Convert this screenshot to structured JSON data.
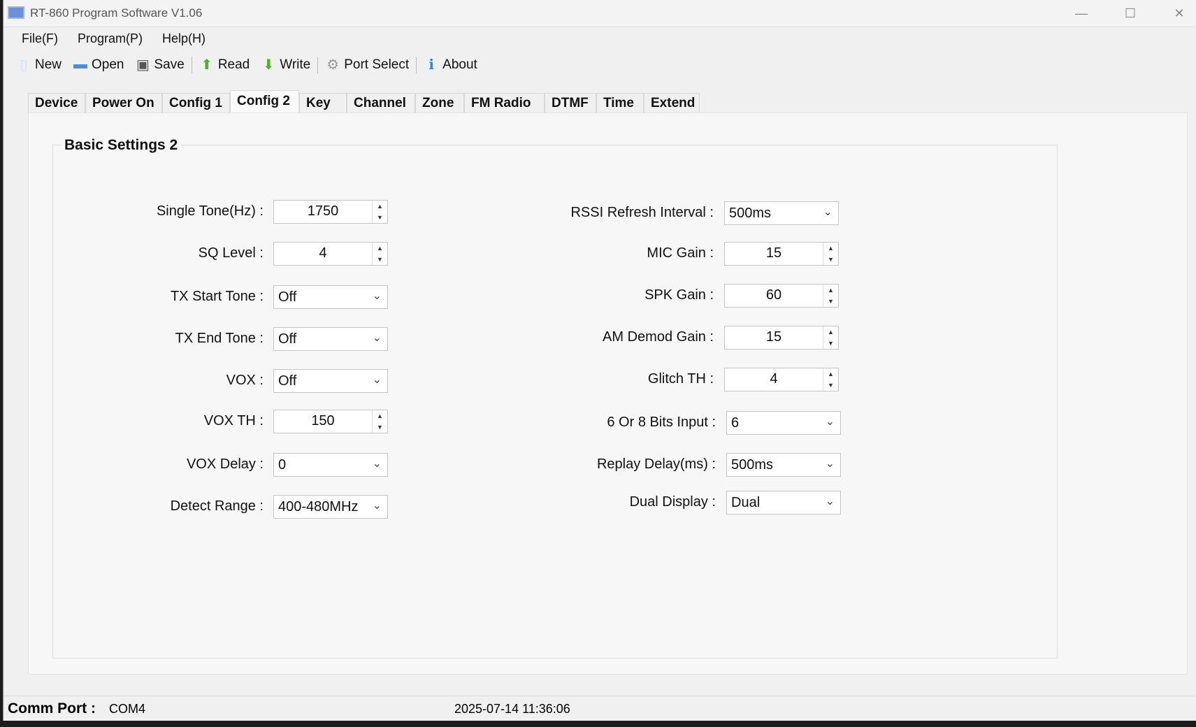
{
  "window": {
    "title": "RT-860 Program Software V1.06",
    "minimize": "—",
    "maximize": "☐",
    "close": "✕"
  },
  "menu": [
    "File(F)",
    "Program(P)",
    "Help(H)"
  ],
  "toolbar": [
    {
      "label": "New",
      "icon": "new-file-icon",
      "color": "#cfe3f7"
    },
    {
      "label": "Open",
      "icon": "folder-icon",
      "color": "#4a8fd8"
    },
    {
      "label": "Save",
      "icon": "save-icon",
      "color": "#555555"
    },
    {
      "label": "Read",
      "icon": "arrow-up-icon",
      "color": "#4cb52e"
    },
    {
      "label": "Write",
      "icon": "arrow-down-icon",
      "color": "#4cb52e"
    },
    {
      "label": "Port Select",
      "icon": "gear-icon",
      "color": "#999999"
    },
    {
      "label": "About",
      "icon": "info-icon",
      "color": "#3f7fd6"
    }
  ],
  "tabs": [
    "Device",
    "Power On",
    "Config 1",
    "Config 2",
    "Key",
    "Channel",
    "Zone",
    "FM Radio",
    "DTMF",
    "Time",
    "Extend"
  ],
  "active_tab": "Config 2",
  "group_title": "Basic Settings 2",
  "left_fields": [
    {
      "label": "Single Tone(Hz) :",
      "value": "1750",
      "type": "spin"
    },
    {
      "label": "SQ Level :",
      "value": "4",
      "type": "spin"
    },
    {
      "label": "TX Start Tone :",
      "value": "Off",
      "type": "combo"
    },
    {
      "label": "TX End Tone :",
      "value": "Off",
      "type": "combo"
    },
    {
      "label": "VOX :",
      "value": "Off",
      "type": "combo"
    },
    {
      "label": "VOX TH :",
      "value": "150",
      "type": "spin"
    },
    {
      "label": "VOX Delay :",
      "value": "0",
      "type": "combo"
    },
    {
      "label": "Detect Range :",
      "value": "400-480MHz",
      "type": "combo"
    }
  ],
  "right_fields": [
    {
      "label": "RSSI Refresh Interval :",
      "value": "500ms",
      "type": "combo"
    },
    {
      "label": "MIC Gain :",
      "value": "15",
      "type": "spin"
    },
    {
      "label": "SPK Gain :",
      "value": "60",
      "type": "spin"
    },
    {
      "label": "AM Demod Gain :",
      "value": "15",
      "type": "spin"
    },
    {
      "label": "Glitch TH :",
      "value": "4",
      "type": "spin"
    },
    {
      "label": "6 Or 8 Bits Input :",
      "value": "6",
      "type": "combo"
    },
    {
      "label": "Replay Delay(ms) :",
      "value": "500ms",
      "type": "combo"
    },
    {
      "label": "Dual Display :",
      "value": "Dual",
      "type": "combo"
    }
  ],
  "status": {
    "comm_port_label": "Comm Port :",
    "comm_port": "COM4",
    "datetime": "2025-07-14 11:36:06"
  }
}
